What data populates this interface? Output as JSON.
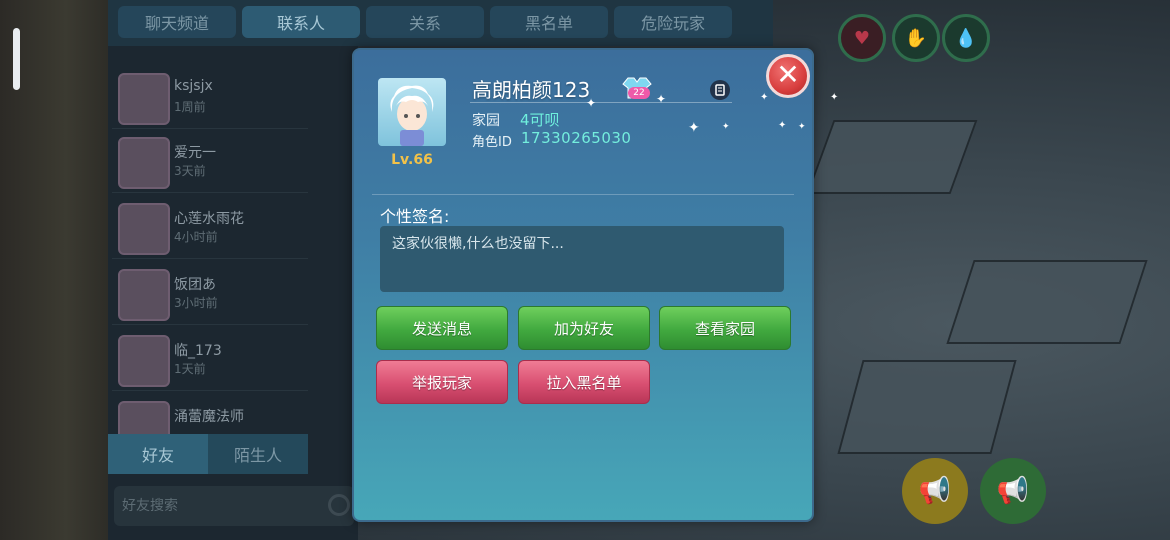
{
  "top_tabs": [
    "聊天频道",
    "联系人",
    "关系",
    "黑名单",
    "危险玩家"
  ],
  "active_top_tab": "联系人",
  "contacts": [
    {
      "name": "ksjsjx",
      "time": "1周前"
    },
    {
      "name": "爱元一",
      "time": "3天前"
    },
    {
      "name": "心莲水雨花",
      "time": "4小时前"
    },
    {
      "name": "饭团あ",
      "time": "3小时前"
    },
    {
      "name": "临_173",
      "time": "1天前"
    },
    {
      "name": "涌蕾魔法师",
      "time": ""
    }
  ],
  "bottom_tabs": [
    "好友",
    "陌生人"
  ],
  "search": {
    "placeholder": "好友搜索"
  },
  "profile": {
    "name": "高朗柏颜123",
    "vip_level": "22",
    "level": "Lv.66",
    "home_label": "家园",
    "home_value": "4可呗",
    "id_label": "角色ID",
    "id_value": "17330265030"
  },
  "signature": {
    "title": "个性签名:",
    "text": "这家伙很懒,什么也没留下..."
  },
  "actions": {
    "send_message": "发送消息",
    "add_friend": "加为好友",
    "view_home": "查看家园",
    "report_player": "举报玩家",
    "blacklist": "拉入黑名单"
  },
  "colors": {
    "modal_top": "#3c6e9c",
    "modal_bottom": "#47a7b8",
    "green_button": "#41a93f",
    "pink_button": "#d84f71",
    "close_button": "#d83e3e",
    "level_gold": "#f2c249",
    "id_teal": "#74eedd"
  },
  "icons": {
    "close": "close-icon",
    "copy": "copy-icon",
    "vip": "vip-shirt-icon",
    "search": "search-icon",
    "heart": "heart-icon",
    "drop": "water-drop-icon",
    "horn": "megaphone-icon"
  }
}
